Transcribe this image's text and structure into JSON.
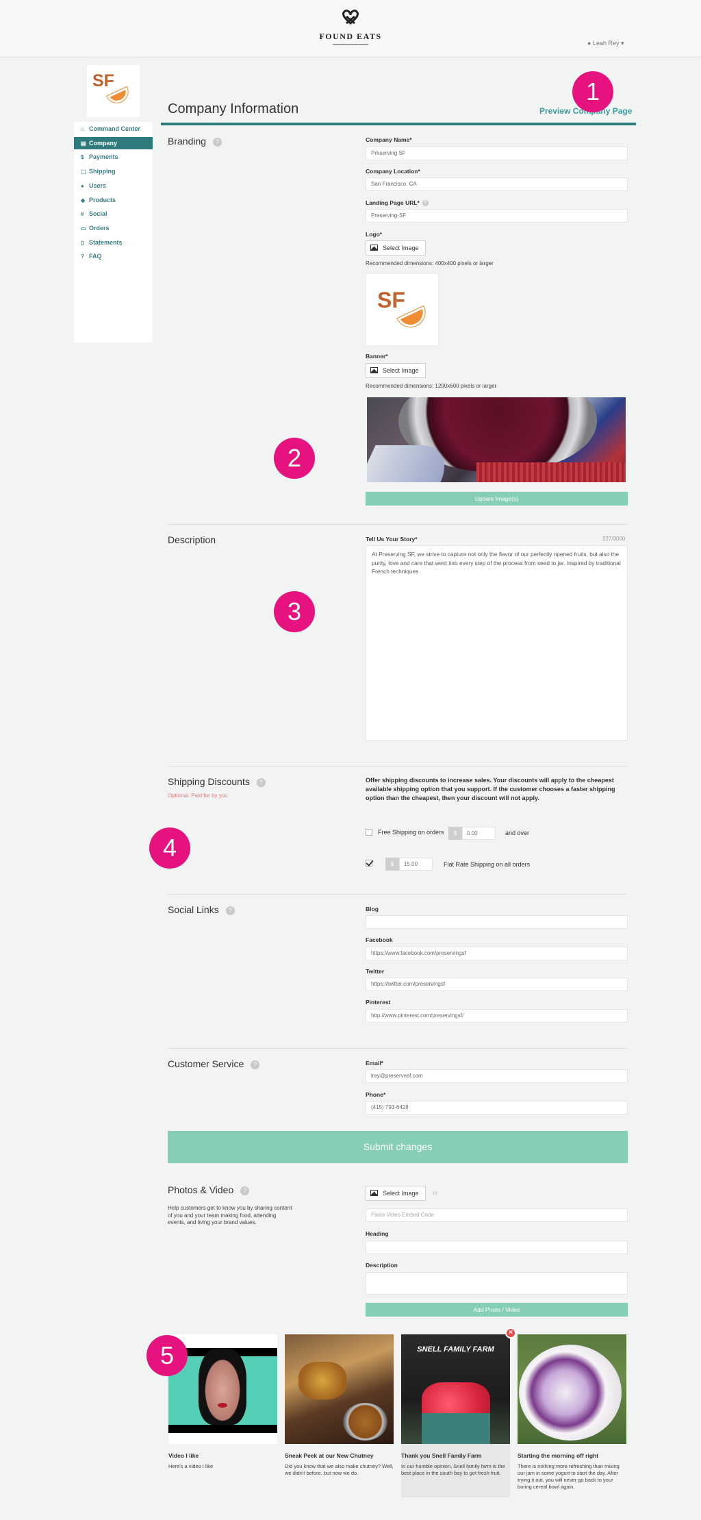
{
  "header": {
    "brand_name": "FOUND EATS",
    "user_name": "Leah Rey",
    "user_caret": "▾"
  },
  "sidebar": {
    "logo_text": "SF",
    "items": [
      {
        "label": "Command Center",
        "icon": "home-icon",
        "glyph": "⌂"
      },
      {
        "label": "Company",
        "icon": "store-icon",
        "glyph": "▤",
        "active": true
      },
      {
        "label": "Payments",
        "icon": "dollar-icon",
        "glyph": "$"
      },
      {
        "label": "Shipping",
        "icon": "box-icon",
        "glyph": "⬚"
      },
      {
        "label": "Users",
        "icon": "user-icon",
        "glyph": "●"
      },
      {
        "label": "Products",
        "icon": "tag-icon",
        "glyph": "◆"
      },
      {
        "label": "Social",
        "icon": "hash-icon",
        "glyph": "#"
      },
      {
        "label": "Orders",
        "icon": "cart-icon",
        "glyph": "▭"
      },
      {
        "label": "Statements",
        "icon": "document-icon",
        "glyph": "▯"
      },
      {
        "label": "FAQ",
        "icon": "question-icon",
        "glyph": "?"
      }
    ]
  },
  "main": {
    "title": "Company Information",
    "preview_link": "Preview Company Page",
    "branding": {
      "title": "Branding",
      "company_name_label": "Company Name*",
      "company_name_value": "Preserving SF",
      "location_label": "Company Location*",
      "location_value": "San Francisco, CA",
      "url_label": "Landing Page URL*",
      "url_value": "Preserving-SF",
      "logo_label": "Logo*",
      "select_image": "Select Image",
      "logo_note": "Recommended dimensions: 400x400 pixels or larger",
      "banner_label": "Banner*",
      "banner_note": "Recommended dimensions: 1200x600 pixels or larger",
      "update_button": "Update Image(s)"
    },
    "description": {
      "title": "Description",
      "story_label": "Tell Us Your Story*",
      "counter": "227/3000",
      "story_text": "At Preserving SF, we strive to capture not only the flavor of our perfectly ripened fruits, but also the purity, love and care that went into every step of the process from seed to jar. Inspired by traditional French techniques"
    },
    "shipping": {
      "title": "Shipping Discounts",
      "optional": "Optional. Paid for by you",
      "info": "Offer shipping discounts to increase sales. Your discounts will apply to the cheapest available shipping option that you support. If the customer chooses a faster shipping option than the cheapest, then your discount will not apply.",
      "free_label": "Free Shipping on orders",
      "currency": "$",
      "free_value": "0.00",
      "and_over": "and over",
      "free_checked": false,
      "flat_value": "15.00",
      "flat_label": "Flat Rate Shipping on all orders",
      "flat_checked": true
    },
    "social": {
      "title": "Social Links",
      "blog_label": "Blog",
      "blog_value": "",
      "facebook_label": "Facebook",
      "facebook_value": "https://www.facebook.com/preservingsf",
      "twitter_label": "Twitter",
      "twitter_value": "https://twitter.com/preservingsf",
      "pinterest_label": "Pinterest",
      "pinterest_value": "http://www.pinterest.com/preservingsf/"
    },
    "customer_service": {
      "title": "Customer Service",
      "email_label": "Email*",
      "email_value": "lrey@preservesf.com",
      "phone_label": "Phone*",
      "phone_value": "(415) 793-6428"
    },
    "submit": "Submit changes",
    "photos": {
      "title": "Photos & Video",
      "description": "Help customers get to know you by sharing content of you and your team making food, attending events, and living your brand values.",
      "select_image": "Select Image",
      "or": "or",
      "embed_placeholder": "Paste Video Embed Code",
      "heading_label": "Heading",
      "description_label": "Description",
      "add_button": "Add Photo / Video"
    },
    "gallery": [
      {
        "title": "Video I like",
        "text": "Here's a video I like"
      },
      {
        "title": "Sneak Peek at our New Chutney",
        "text": "Did you know that we also make chutney? Well, we didn't before, but now we do."
      },
      {
        "title": "Thank you Snell Family Farm",
        "text": "In our humble opinion, Snell family farm is the best place in the south bay to get fresh fruit.",
        "photo_text": "SNELL FAMILY FARM"
      },
      {
        "title": "Starting the morning off right",
        "text": "There is nothing more refreshing than mixing our jam in some yogurt to start the day. After trying it out, you will never go back to your boring cereal bowl again."
      }
    ]
  },
  "annotations": [
    "1",
    "2",
    "3",
    "4",
    "5"
  ],
  "colors": {
    "accent": "#2f7a7c",
    "link": "#3a9ca0",
    "button": "#86ceb4",
    "badge": "#e6127f",
    "logo_brown": "#c0622d",
    "logo_orange": "#f08c33"
  }
}
